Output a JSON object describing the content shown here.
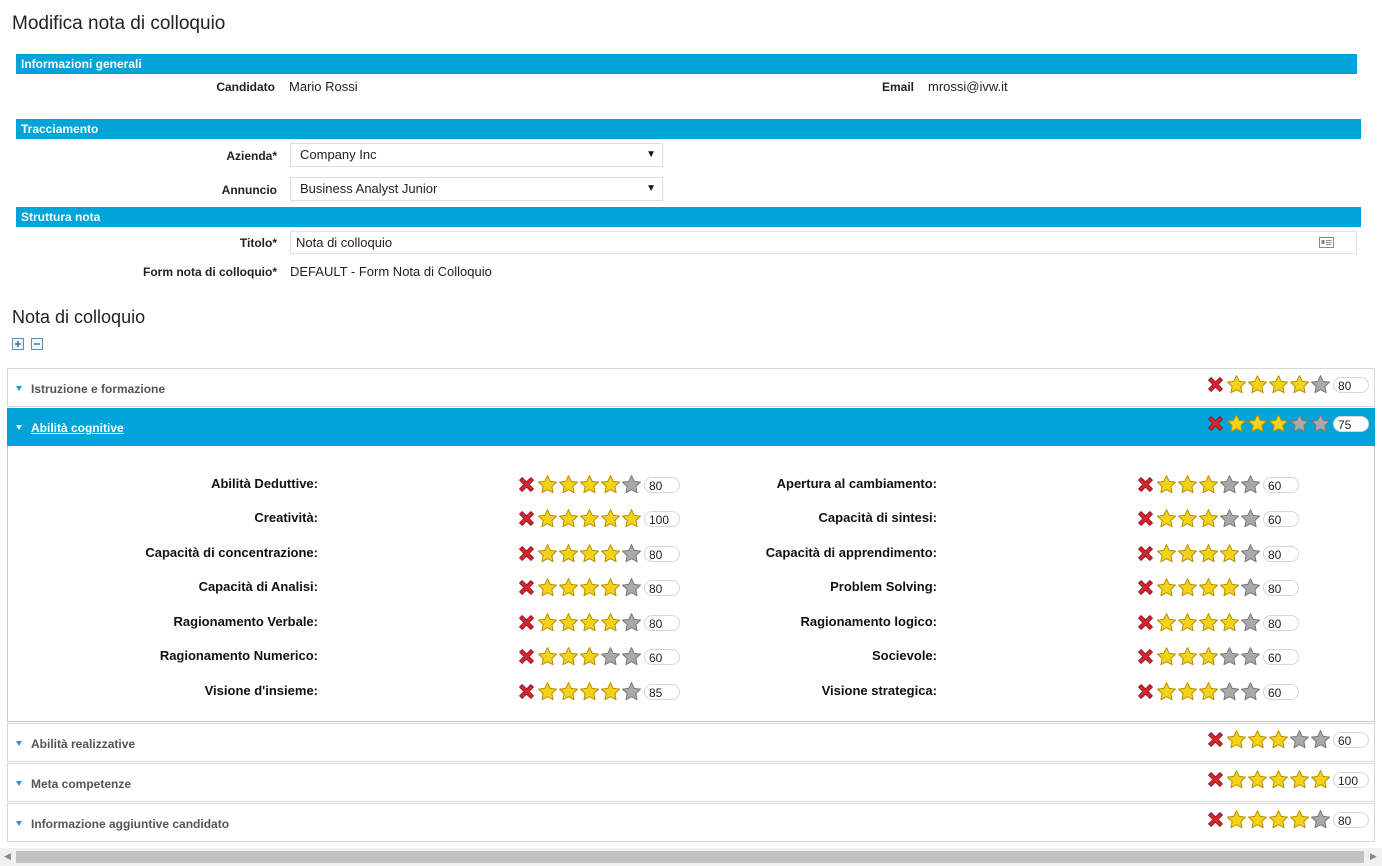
{
  "page": {
    "title": "Modifica nota di colloquio"
  },
  "general": {
    "header": "Informazioni generali",
    "candidate_label": "Candidato",
    "candidate_value": "Mario Rossi",
    "email_label": "Email",
    "email_value": "mrossi@ivw.it"
  },
  "tracking": {
    "header": "Tracciamento",
    "company_label": "Azienda*",
    "company_value": "Company Inc",
    "ad_label": "Annuncio",
    "ad_value": "Business Analyst Junior"
  },
  "structure": {
    "header": "Struttura nota",
    "title_label": "Titolo*",
    "title_value": "Nota di colloquio",
    "form_label": "Form nota di colloquio*",
    "form_value": "DEFAULT - Form Nota di Colloquio"
  },
  "note": {
    "title": "Nota di colloquio",
    "expand_icon": "expand-all-icon",
    "collapse_icon": "collapse-all-icon"
  },
  "colors": {
    "accent": "#00a4d8",
    "star_on": "#f2d21b",
    "star_off": "#a9a9a9",
    "clear_x": "#d62630"
  },
  "sections": [
    {
      "title": "Istruzione e formazione",
      "stars": 4,
      "score": "80"
    },
    {
      "title": "Abilità cognitive",
      "stars": 3,
      "score": "75",
      "expanded": true
    },
    {
      "title": "Abilità realizzative",
      "stars": 3,
      "score": "60"
    },
    {
      "title": "Meta competenze",
      "stars": 5,
      "score": "100"
    },
    {
      "title": "Informazione aggiuntive candidato",
      "stars": 4,
      "score": "80"
    }
  ],
  "cognitive": {
    "left": [
      {
        "label": "Abilità Deduttive:",
        "stars": 4,
        "score": "80"
      },
      {
        "label": "Creatività:",
        "stars": 5,
        "score": "100"
      },
      {
        "label": "Capacità di concentrazione:",
        "stars": 4,
        "score": "80"
      },
      {
        "label": "Capacità di Analisi:",
        "stars": 4,
        "score": "80"
      },
      {
        "label": "Ragionamento Verbale:",
        "stars": 4,
        "score": "80"
      },
      {
        "label": "Ragionamento Numerico:",
        "stars": 3,
        "score": "60"
      },
      {
        "label": "Visione d'insieme:",
        "stars": 4,
        "score": "85"
      }
    ],
    "right": [
      {
        "label": "Apertura al cambiamento:",
        "stars": 3,
        "score": "60"
      },
      {
        "label": "Capacità di sintesi:",
        "stars": 3,
        "score": "60"
      },
      {
        "label": "Capacità di apprendimento:",
        "stars": 4,
        "score": "80"
      },
      {
        "label": "Problem Solving:",
        "stars": 4,
        "score": "80"
      },
      {
        "label": "Ragionamento logico:",
        "stars": 4,
        "score": "80"
      },
      {
        "label": "Socievole:",
        "stars": 3,
        "score": "60"
      },
      {
        "label": "Visione strategica:",
        "stars": 3,
        "score": "60"
      }
    ]
  }
}
